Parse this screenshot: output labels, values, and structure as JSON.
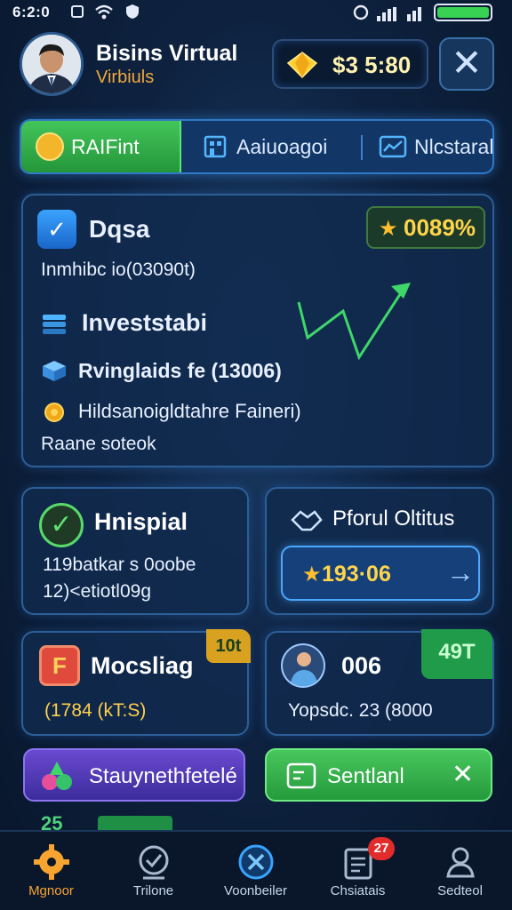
{
  "status_bar": {
    "time": "6:2:0"
  },
  "header": {
    "title": "Bisins Virtual",
    "subtitle": "Virbiuls",
    "balance": "$3 5:80",
    "close_icon": "close-icon"
  },
  "tabs": [
    {
      "label": "RAIFint",
      "icon": "coin-icon"
    },
    {
      "label": "Aaiuoagoi",
      "icon": "building-icon"
    },
    {
      "label": "Nlcstaral",
      "icon": "chart-icon"
    }
  ],
  "investment_card": {
    "title": "Dqsa",
    "percent": "0089%",
    "line1": "Inmhibc io(03090t)",
    "line2": "Investstabi",
    "line3": "Rvinglaids fe (13006)",
    "line4": "Hildsanoigldtahre Faineri)",
    "line5": "Raane soteok"
  },
  "card_hospital": {
    "title": "Hnispial",
    "text1": "119batkar s 0oobe",
    "text2": "12)<etiotl09g"
  },
  "card_portfolio": {
    "title": "Pforul Oltitus",
    "amount": "193·06"
  },
  "card_messaging": {
    "title": "Mocsliag",
    "badge": "10t",
    "text": "(1784 (kT:S)"
  },
  "card_person": {
    "title": "006",
    "badge": "49T",
    "text": "Yopsdc. 23 (8000"
  },
  "action_left": {
    "label": "Stauynethfetelé"
  },
  "action_right": {
    "label": "Sentlanl"
  },
  "peek_text": "25",
  "nav": [
    {
      "label": "Mgnoor",
      "icon": "gear-icon"
    },
    {
      "label": "Trilone",
      "icon": "check-circle-icon"
    },
    {
      "label": "Voonbeiler",
      "icon": "x-circle-icon"
    },
    {
      "label": "Chsiatais",
      "icon": "clipboard-icon"
    },
    {
      "label": "Sedteol",
      "icon": "user-icon"
    }
  ],
  "nav_badge": "27",
  "colors": {
    "accent": "#2f79c7",
    "green": "#3fbf57",
    "gold": "#ffd54a",
    "nav_active": "#f7a431"
  }
}
